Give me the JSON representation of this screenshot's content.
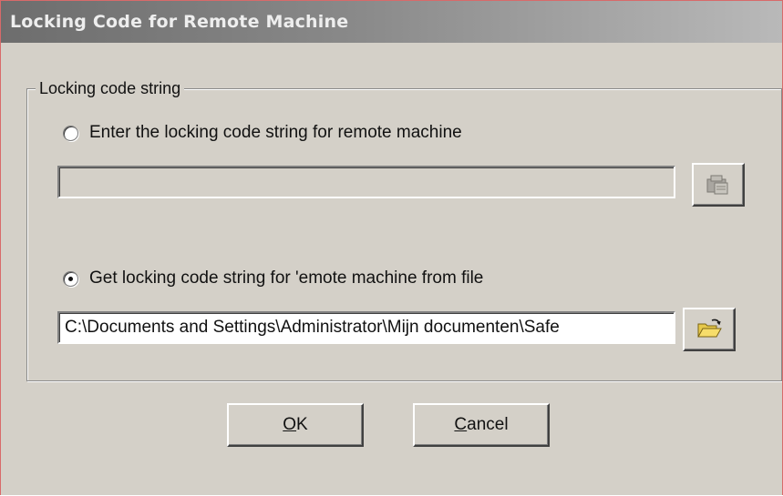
{
  "window": {
    "title": "Locking Code for Remote Machine",
    "title_colors": [
      "#6d6d6d",
      "#b9b9b9"
    ]
  },
  "group": {
    "legend": "Locking code string"
  },
  "option_manual": {
    "label": "Enter the locking code string for remote machine",
    "selected": false,
    "field_value": "",
    "button_icon": "paste-icon"
  },
  "option_file": {
    "label": "Get locking code string for 'emote machine from file",
    "selected": true,
    "field_value": "C:\\Documents and Settings\\Administrator\\Mijn documenten\\Safe",
    "button_icon": "open-folder-icon"
  },
  "buttons": {
    "ok": {
      "accel": "O",
      "rest": "K"
    },
    "cancel": {
      "accel": "C",
      "rest": "ancel"
    }
  }
}
